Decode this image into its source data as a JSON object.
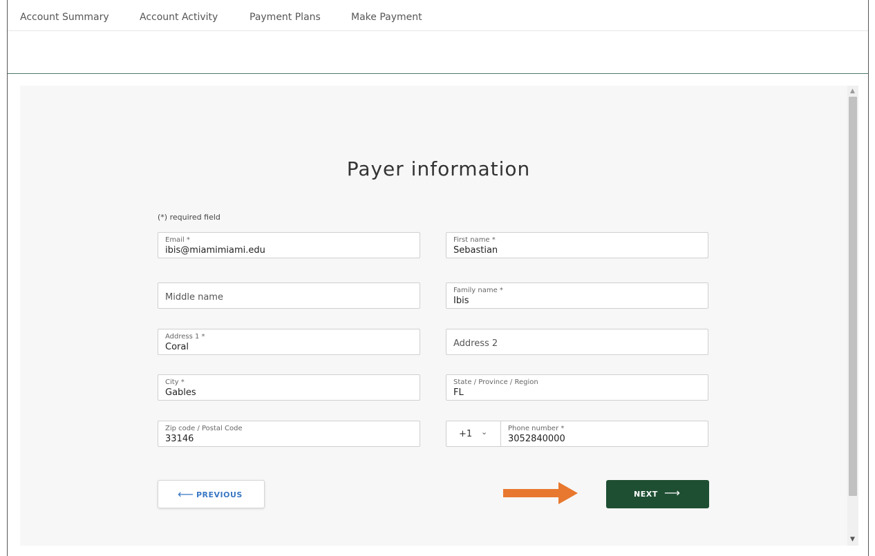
{
  "nav": {
    "items": [
      "Account Summary",
      "Account Activity",
      "Payment Plans",
      "Make Payment"
    ]
  },
  "form": {
    "title": "Payer information",
    "required_note": "(*) required field",
    "email": {
      "label": "Email *",
      "value": "ibis@miamimiami.edu"
    },
    "first_name": {
      "label": "First name *",
      "value": "Sebastian"
    },
    "middle_name": {
      "placeholder": "Middle name"
    },
    "family_name": {
      "label": "Family name *",
      "value": "Ibis"
    },
    "address1": {
      "label": "Address 1 *",
      "value": "Coral"
    },
    "address2": {
      "placeholder": "Address 2"
    },
    "city": {
      "label": "City *",
      "value": "Gables"
    },
    "state": {
      "label": "State / Province / Region",
      "value": "FL"
    },
    "zip": {
      "label": "Zip code / Postal Code",
      "value": "33146"
    },
    "phone": {
      "country_code": "+1",
      "label": "Phone number *",
      "value": "3052840000"
    }
  },
  "buttons": {
    "previous": {
      "label": "PREVIOUS",
      "icon": "arrow-left-icon"
    },
    "next": {
      "label": "NEXT",
      "icon": "arrow-right-icon"
    }
  },
  "colors": {
    "next_bg": "#1f4f33",
    "prev_text": "#3a78c4",
    "annotation_arrow": "#e8782f"
  }
}
